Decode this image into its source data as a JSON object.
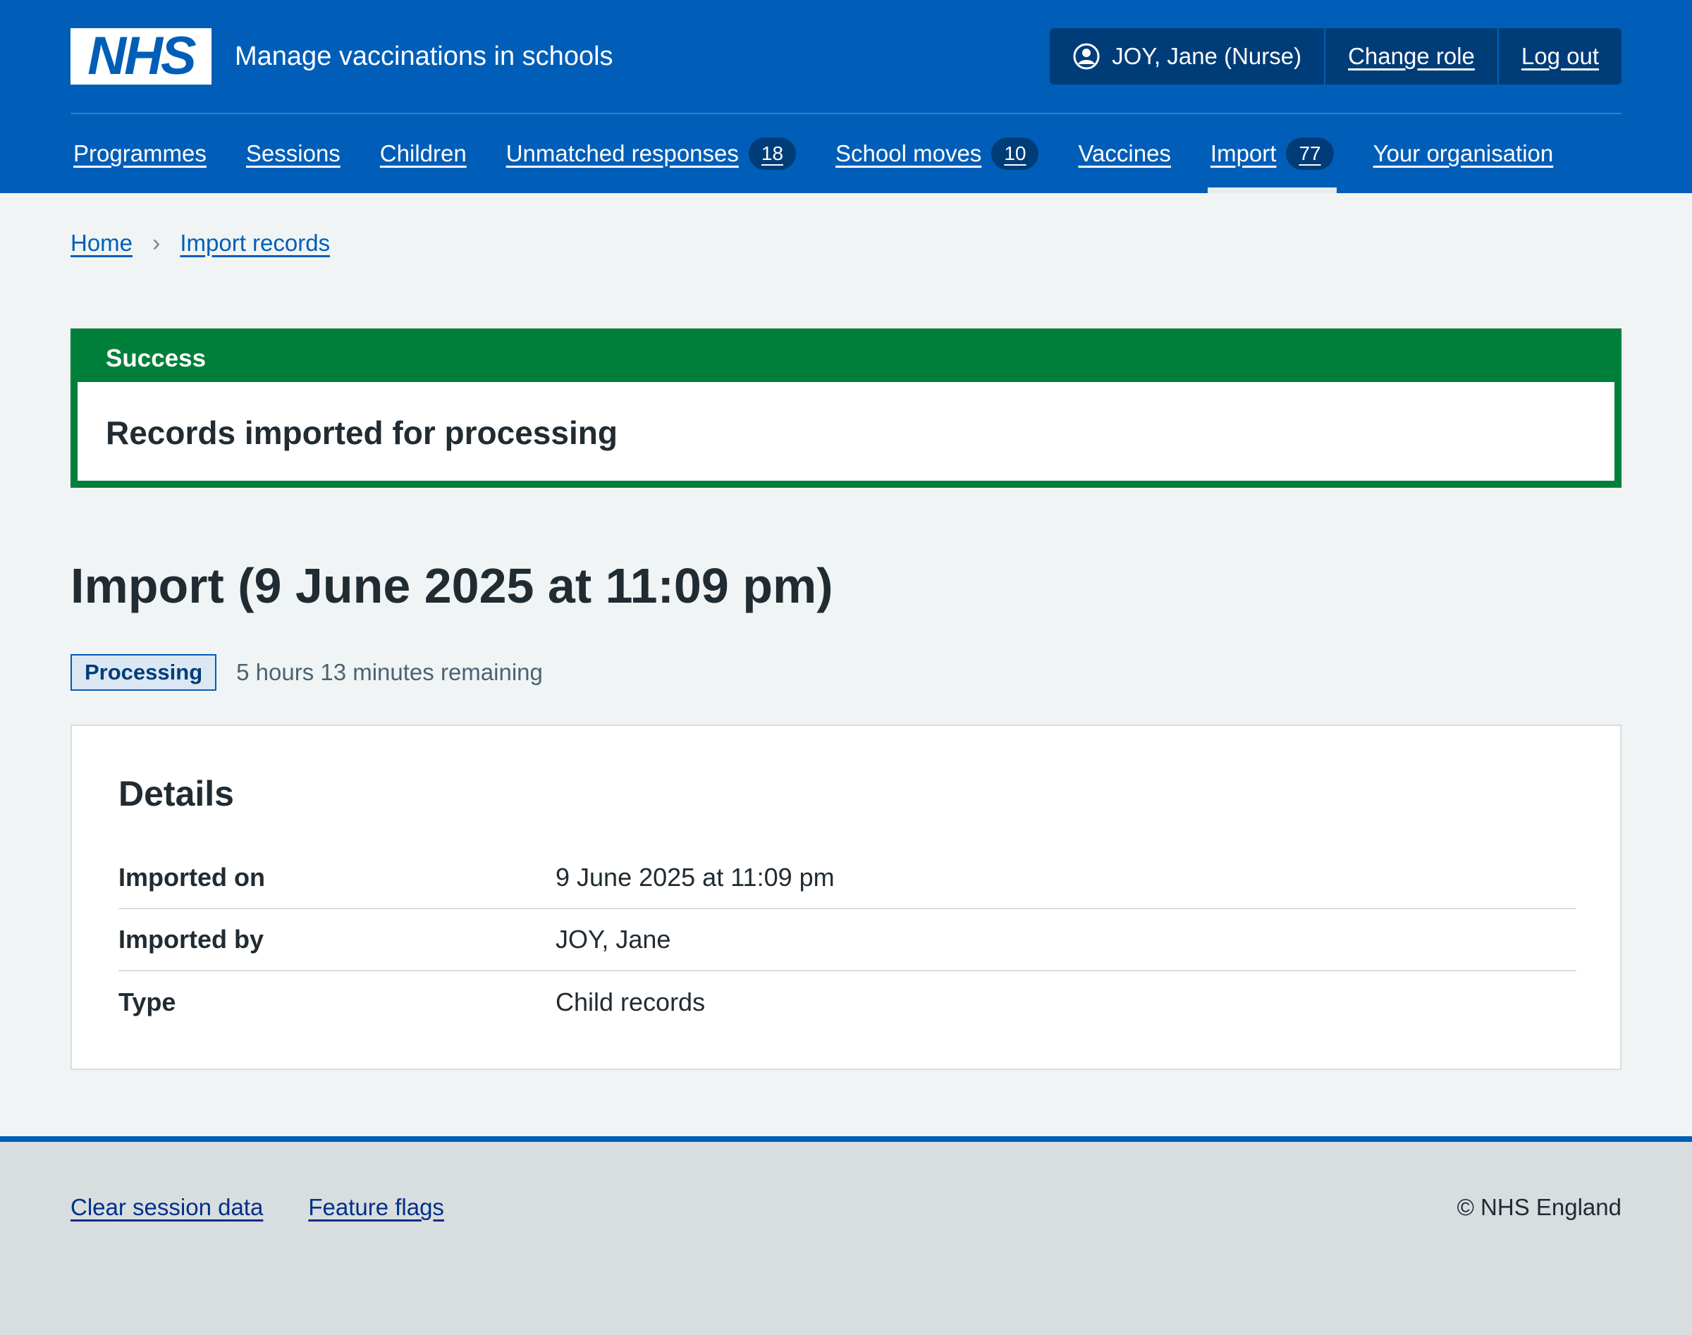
{
  "header": {
    "logo_text": "NHS",
    "service_name": "Manage vaccinations in schools",
    "account": {
      "user_label": "JOY, Jane (Nurse)",
      "change_role": "Change role",
      "log_out": "Log out"
    },
    "nav": [
      {
        "label": "Programmes",
        "count": null,
        "active": false
      },
      {
        "label": "Sessions",
        "count": null,
        "active": false
      },
      {
        "label": "Children",
        "count": null,
        "active": false
      },
      {
        "label": "Unmatched responses",
        "count": "18",
        "active": false
      },
      {
        "label": "School moves",
        "count": "10",
        "active": false
      },
      {
        "label": "Vaccines",
        "count": null,
        "active": false
      },
      {
        "label": "Import",
        "count": "77",
        "active": true
      },
      {
        "label": "Your organisation",
        "count": null,
        "active": false
      }
    ]
  },
  "breadcrumb": {
    "home": "Home",
    "separator": "›",
    "current": "Import records"
  },
  "banner": {
    "title": "Success",
    "message": "Records imported for processing",
    "color": "#007f3b"
  },
  "page": {
    "title": "Import (9 June 2025 at 11:09 pm)",
    "status_tag": "Processing",
    "remaining": "5 hours 13 minutes remaining"
  },
  "details": {
    "title": "Details",
    "rows": [
      {
        "key": "Imported on",
        "value": "9 June 2025 at 11:09 pm"
      },
      {
        "key": "Imported by",
        "value": "JOY, Jane"
      },
      {
        "key": "Type",
        "value": "Child records"
      }
    ]
  },
  "footer": {
    "links": [
      "Clear session data",
      "Feature flags"
    ],
    "copyright": "© NHS England"
  },
  "colors": {
    "brand_blue": "#005eb8",
    "dark_blue": "#003d78",
    "success_green": "#007f3b",
    "page_bg": "#f0f4f5"
  },
  "icons": {
    "account": "user-circle-icon",
    "breadcrumb_separator": "chevron-right-icon"
  }
}
